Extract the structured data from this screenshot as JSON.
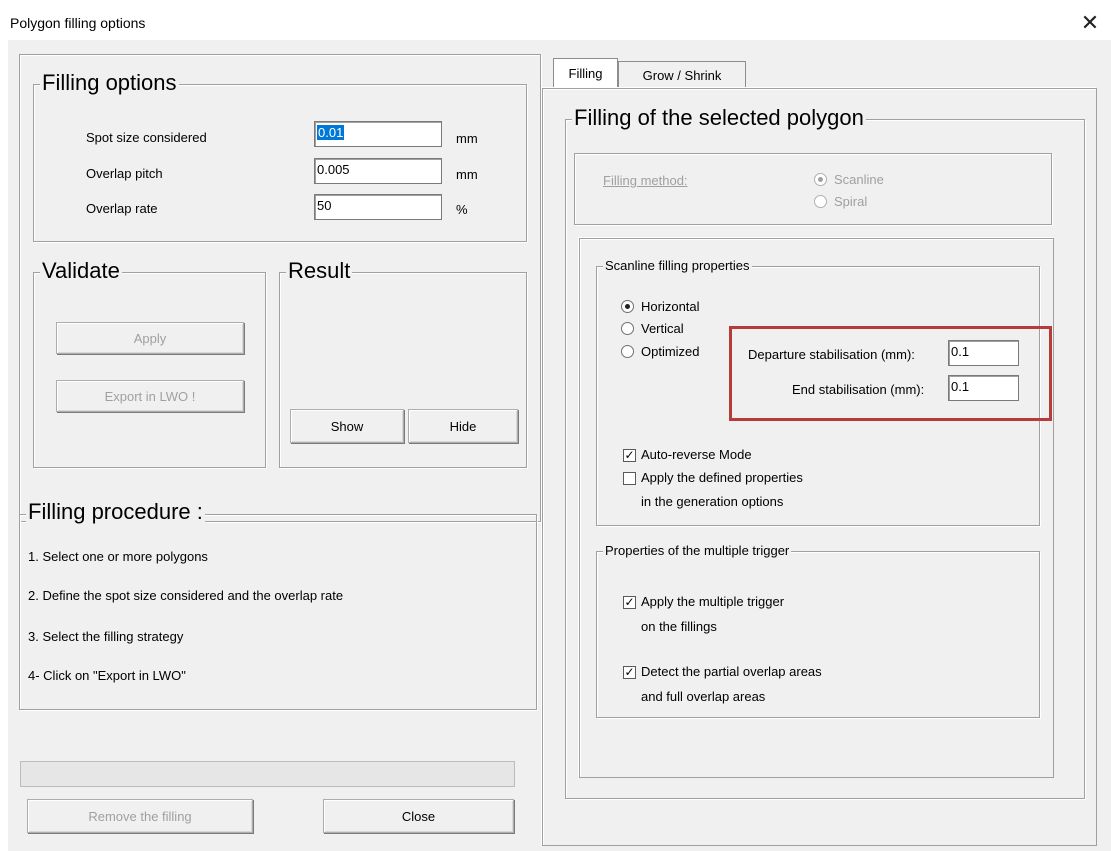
{
  "window": {
    "title": "Polygon filling options",
    "close_glyph": "✕"
  },
  "filling_options": {
    "title": "Filling options",
    "fields": [
      {
        "label": "Spot size considered",
        "value": "0.01",
        "unit": "mm"
      },
      {
        "label": "Overlap pitch",
        "value": "0.005",
        "unit": "mm"
      },
      {
        "label": "Overlap rate",
        "value": "50",
        "unit": "%"
      }
    ]
  },
  "validate": {
    "title": "Validate",
    "apply_label": "Apply",
    "export_label": "Export in LWO !"
  },
  "result": {
    "title": "Result",
    "show_label": "Show",
    "hide_label": "Hide"
  },
  "procedure": {
    "title": "Filling procedure :",
    "steps": [
      "1. Select one or more polygons",
      "2. Define the spot size considered and the overlap rate",
      "3. Select the filling strategy",
      "4- Click on \"Export in LWO\""
    ]
  },
  "footer": {
    "remove_label": "Remove the filling",
    "close_label": "Close"
  },
  "tabs": [
    {
      "label": "Filling",
      "active": true
    },
    {
      "label": "Grow / Shrink",
      "active": false
    }
  ],
  "filling_panel": {
    "title": "Filling of the selected polygon",
    "method_label": "Filling method:",
    "methods": [
      {
        "label": "Scanline",
        "selected": true
      },
      {
        "label": "Spiral",
        "selected": false
      }
    ],
    "scanline": {
      "title": "Scanline filling properties",
      "directions": [
        {
          "label": "Horizontal",
          "selected": true
        },
        {
          "label": "Vertical",
          "selected": false
        },
        {
          "label": "Optimized",
          "selected": false
        }
      ],
      "departure_label": "Departure stabilisation (mm):",
      "departure_value": "0.1",
      "end_label": "End stabilisation (mm):",
      "end_value": "0.1",
      "auto_reverse_label": "Auto-reverse Mode",
      "auto_reverse_checked": true,
      "apply_defined_label_1": "Apply the defined properties",
      "apply_defined_label_2": "in the generation options",
      "apply_defined_checked": false
    },
    "multiple_trigger": {
      "title": "Properties of the multiple trigger",
      "apply_label_1": "Apply the multiple trigger",
      "apply_label_2": "on the fillings",
      "apply_checked": true,
      "detect_label_1": "Detect the partial overlap areas",
      "detect_label_2": "and full overlap areas",
      "detect_checked": true
    }
  },
  "colors": {
    "highlight": "#b83b3b",
    "selection": "#0078d7",
    "disabled_text": "#a0a0a0",
    "background": "#f0f0f0"
  }
}
